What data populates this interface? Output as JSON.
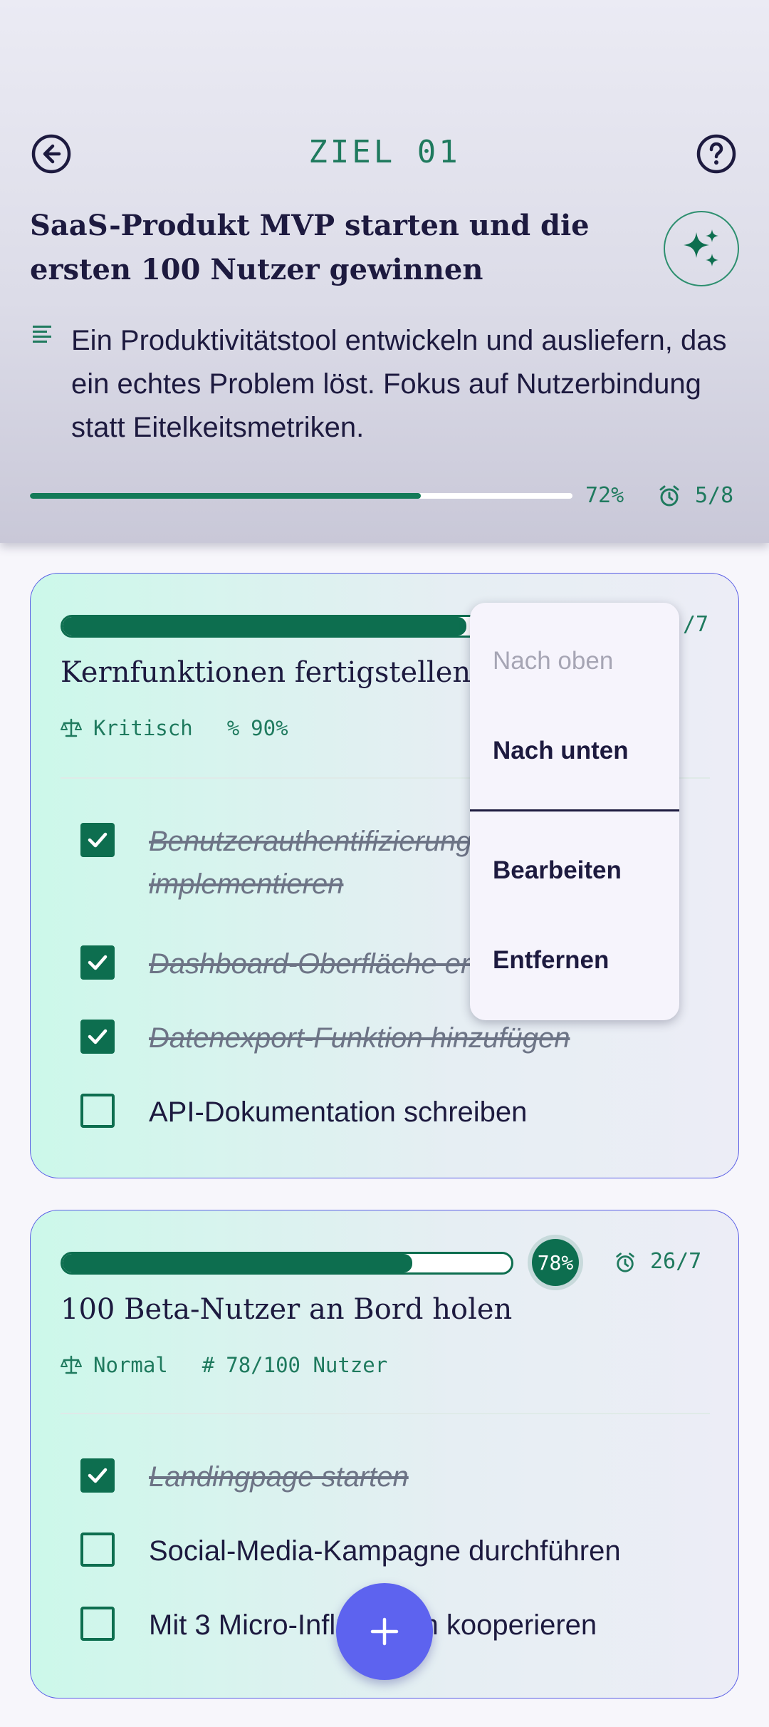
{
  "colors": {
    "accent_green": "#0d6e4f",
    "teal_text": "#1f7a5e",
    "fab_blue": "#5d63ef",
    "card_border": "#5b5fe6",
    "ink": "#1d1a3f"
  },
  "header": {
    "back_icon": "arrow-left-circle-icon",
    "help_icon": "help-circle-icon",
    "goal_label": "ZIEL 01",
    "title": "SaaS-Produkt MVP starten und die ersten 100 Nutzer gewinnen",
    "sparkle_icon": "sparkles-icon",
    "notes_icon": "notes-icon",
    "description": "Ein Produktivitätstool entwickeln und ausliefern, das ein echtes Problem löst. Fokus auf Nutzerbindung statt Eitelkeitsmetriken.",
    "progress": 0.72,
    "progress_label": "72%",
    "alarm_icon": "alarm-icon",
    "count": "5/8"
  },
  "key_results": [
    {
      "progress": 0.9,
      "date": "/7",
      "title": "Kernfunktionen fertigstellen",
      "priority_icon": "scale-icon",
      "priority": "Kritisch",
      "metric_symbol": "%",
      "metric": "90%",
      "tasks": [
        {
          "label": "Benutzerauthentifizierung implementieren",
          "done": true
        },
        {
          "label": "Dashboard-Oberfläche erstellen",
          "done": true
        },
        {
          "label": "Datenexport-Funktion hinzufügen",
          "done": true
        },
        {
          "label": "API-Dokumentation schreiben",
          "done": false
        }
      ]
    },
    {
      "progress": 0.78,
      "badge": "78%",
      "date": "26/7",
      "title": "100 Beta-Nutzer an Bord holen",
      "priority_icon": "scale-icon",
      "priority": "Normal",
      "metric_symbol": "#",
      "metric": "78/100 Nutzer",
      "tasks": [
        {
          "label": "Landingpage starten",
          "done": true
        },
        {
          "label": "Social-Media-Kampagne durchführen",
          "done": false
        },
        {
          "label": "Mit 3 Micro-Influencern kooperieren",
          "done": false
        }
      ]
    }
  ],
  "context_menu": {
    "move_up": "Nach oben",
    "move_down": "Nach unten",
    "edit": "Bearbeiten",
    "remove": "Entfernen"
  },
  "fab": {
    "icon": "plus-icon",
    "label": "+"
  }
}
